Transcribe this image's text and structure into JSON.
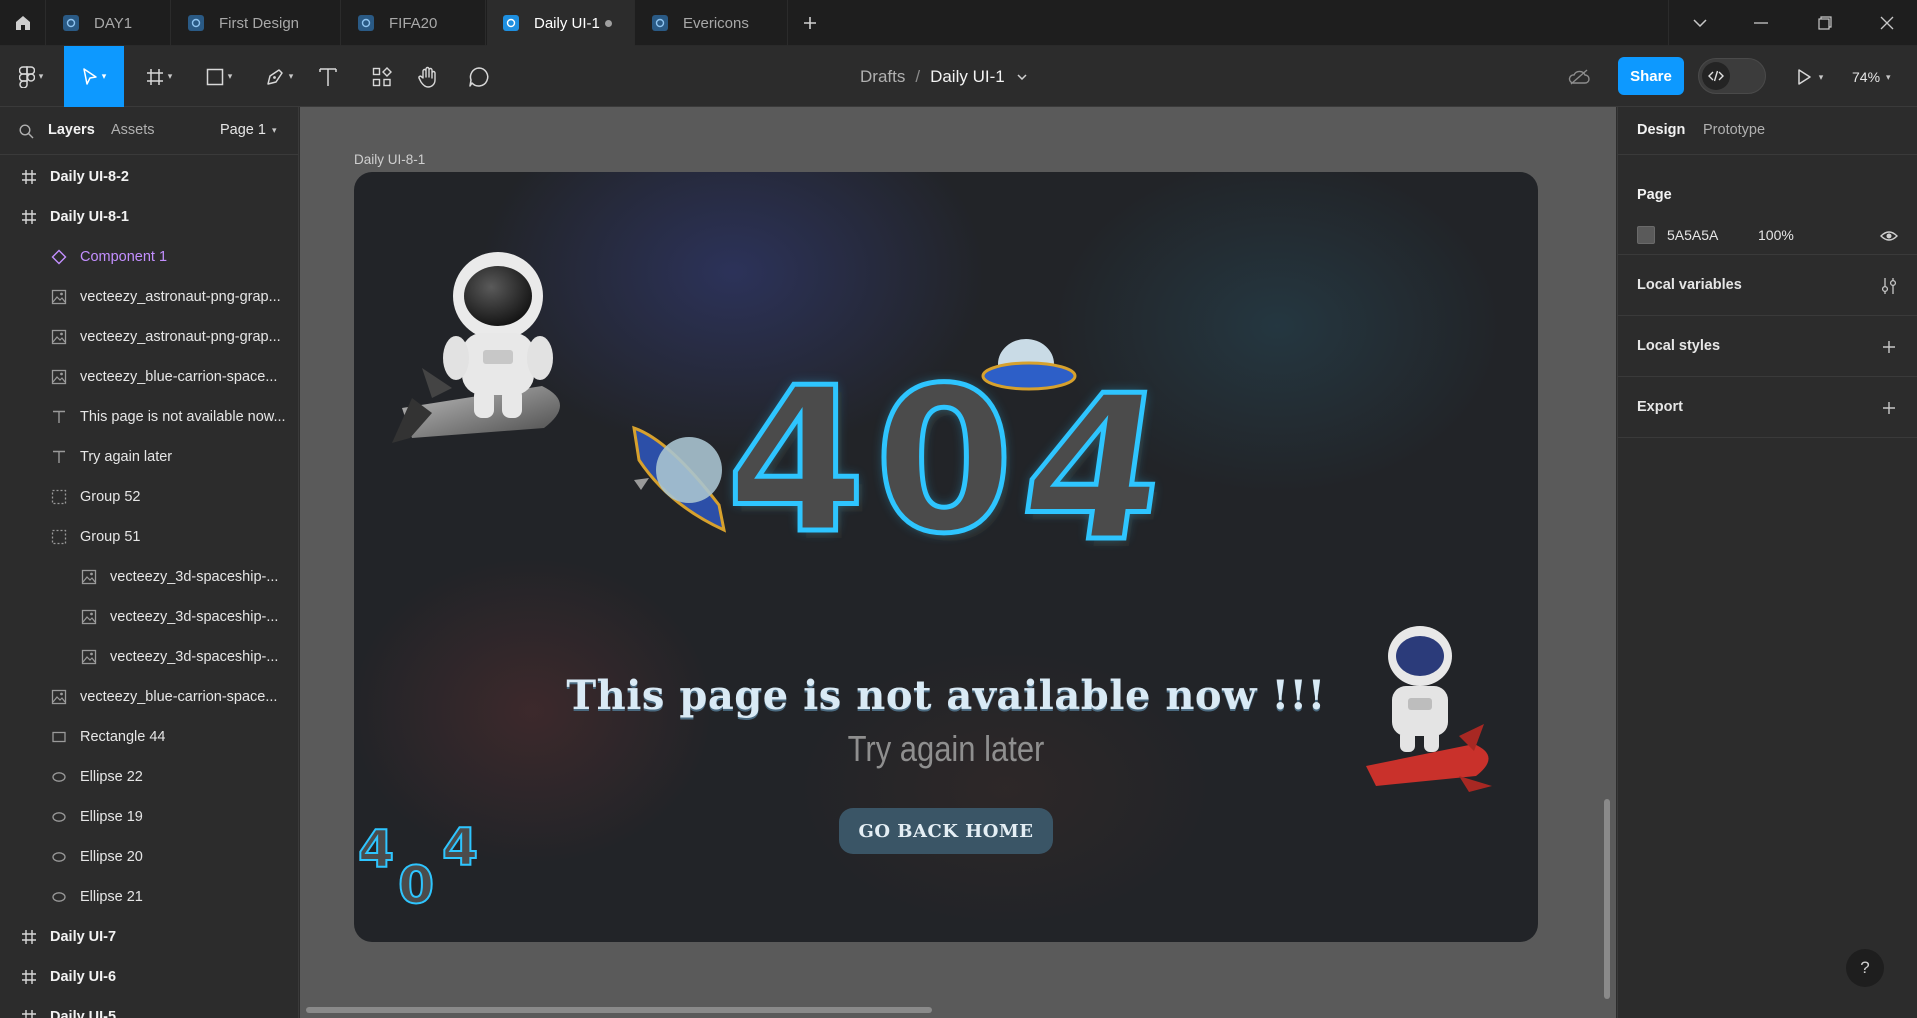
{
  "tabs": [
    {
      "label": "DAY1",
      "active": false
    },
    {
      "label": "First Design",
      "active": false
    },
    {
      "label": "FIFA20",
      "active": false
    },
    {
      "label": "Daily UI-1",
      "active": true
    },
    {
      "label": "Evericons",
      "active": false
    }
  ],
  "toolbar": {
    "breadcrumb_root": "Drafts",
    "breadcrumb_sep": "/",
    "file_name": "Daily UI-1",
    "share_label": "Share",
    "zoom": "74%"
  },
  "left_panel": {
    "tab_layers": "Layers",
    "tab_assets": "Assets",
    "page_selector": "Page 1",
    "layers": [
      {
        "label": "Daily UI-8-2",
        "icon": "frame-icon",
        "indent": 0,
        "bold": true
      },
      {
        "label": "Daily UI-8-1",
        "icon": "frame-icon",
        "indent": 0,
        "bold": true
      },
      {
        "label": "Component 1",
        "icon": "component-icon",
        "indent": 1,
        "bold": false
      },
      {
        "label": "vecteezy_astronaut-png-grap...",
        "icon": "image-icon",
        "indent": 1,
        "bold": false
      },
      {
        "label": "vecteezy_astronaut-png-grap...",
        "icon": "image-icon",
        "indent": 1,
        "bold": false
      },
      {
        "label": "vecteezy_blue-carrion-space...",
        "icon": "image-icon",
        "indent": 1,
        "bold": false
      },
      {
        "label": "This page is not available now...",
        "icon": "text-icon",
        "indent": 1,
        "bold": false
      },
      {
        "label": "Try again later",
        "icon": "text-icon",
        "indent": 1,
        "bold": false
      },
      {
        "label": "Group 52",
        "icon": "group-icon",
        "indent": 1,
        "bold": false
      },
      {
        "label": "Group 51",
        "icon": "group-icon",
        "indent": 1,
        "bold": false
      },
      {
        "label": "vecteezy_3d-spaceship-...",
        "icon": "image-icon",
        "indent": 2,
        "bold": false
      },
      {
        "label": "vecteezy_3d-spaceship-...",
        "icon": "image-icon",
        "indent": 2,
        "bold": false
      },
      {
        "label": "vecteezy_3d-spaceship-...",
        "icon": "image-icon",
        "indent": 2,
        "bold": false
      },
      {
        "label": "vecteezy_blue-carrion-space...",
        "icon": "image-icon",
        "indent": 1,
        "bold": false
      },
      {
        "label": "Rectangle 44",
        "icon": "rectangle-icon",
        "indent": 1,
        "bold": false
      },
      {
        "label": "Ellipse 22",
        "icon": "ellipse-icon",
        "indent": 1,
        "bold": false
      },
      {
        "label": "Ellipse 19",
        "icon": "ellipse-icon",
        "indent": 1,
        "bold": false
      },
      {
        "label": "Ellipse 20",
        "icon": "ellipse-icon",
        "indent": 1,
        "bold": false
      },
      {
        "label": "Ellipse 21",
        "icon": "ellipse-icon",
        "indent": 1,
        "bold": false
      },
      {
        "label": "Daily UI-7",
        "icon": "frame-icon",
        "indent": 0,
        "bold": true
      },
      {
        "label": "Daily UI-6",
        "icon": "frame-icon",
        "indent": 0,
        "bold": true
      },
      {
        "label": "Daily UI-5",
        "icon": "frame-icon",
        "indent": 0,
        "bold": true
      }
    ]
  },
  "canvas": {
    "frame_label": "Daily UI-8-1",
    "frame": {
      "big_digits": [
        "4",
        "0",
        "4"
      ],
      "small_digits": [
        "4",
        "0",
        "4"
      ],
      "headline": "This page is not available now !!!",
      "subheadline": "Try again later",
      "cta_label": "GO BACK HOME"
    }
  },
  "right_panel": {
    "tab_design": "Design",
    "tab_prototype": "Prototype",
    "page_title": "Page",
    "page_color_hex": "5A5A5A",
    "page_opacity": "100%",
    "local_variables": "Local variables",
    "local_styles": "Local styles",
    "export": "Export",
    "help": "?"
  },
  "colors": {
    "accent": "#0d99ff",
    "component": "#c38fff",
    "canvas_bg": "#5a5a5a",
    "neon": "#2ec5ff",
    "cta_bg": "#3a5566"
  }
}
